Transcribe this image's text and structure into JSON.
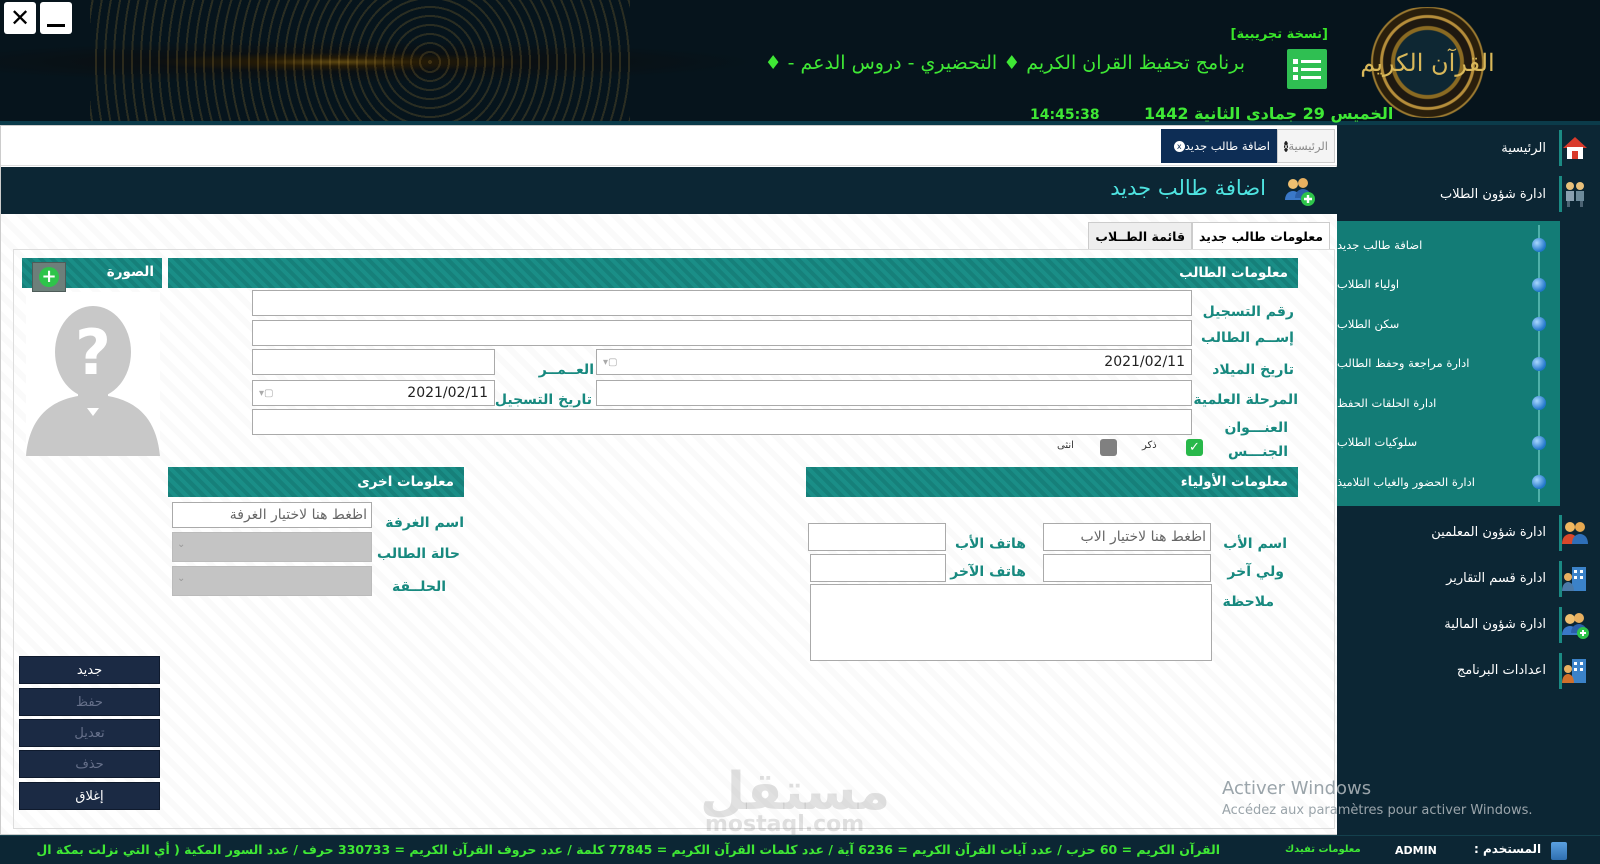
{
  "window": {
    "close_glyph": "✕"
  },
  "header": {
    "trial_badge": "[نسخة تجريبية]",
    "app_title": "برنامج تحفيظ القران الكريم ♦ التحضيري - دروس الدعم - ♦",
    "date": "الخميس 29 جمادى الثانية 1442",
    "time": "14:45:38",
    "seal_text": "القرآن الكريم"
  },
  "sidebar": {
    "items_top": [
      {
        "label": "الرئيسية",
        "icon": "home-icon"
      },
      {
        "label": "ادارة شؤون الطلاب",
        "icon": "students-icon"
      }
    ],
    "submenu": [
      "اضافة طالب جديد",
      "اولياء الطلاب",
      "سكن الطلاب",
      "ادارة مراجعة وحفظ الطالب",
      "ادارة الحلقات الحفظ",
      "سلوكيات الطلاب",
      "ادارة الحضور والغياب التلاميذ"
    ],
    "items_bottom": [
      {
        "label": "ادارة شؤون المعلمين",
        "icon": "teachers-icon"
      },
      {
        "label": "ادارة قسم التقارير",
        "icon": "reports-icon"
      },
      {
        "label": "ادارة شؤون المالية",
        "icon": "finance-icon"
      },
      {
        "label": "اعدادات البرنامج",
        "icon": "settings-icon"
      }
    ]
  },
  "tabs": {
    "home": "الرئيسية",
    "new_student": "اضافة طالب جديد",
    "close_glyph": "x"
  },
  "page": {
    "title": "اضافة طالب جديد",
    "subtabs": {
      "info": "معلومات طالب جديد",
      "list": "قائمة الطــلاب"
    }
  },
  "photo": {
    "label": "الصورة",
    "add_glyph": "+",
    "avatar_glyph": "?"
  },
  "student_info": {
    "section_title": "معلومات الطالب",
    "reg_number_label": "رقم التسجيل",
    "name_label": "إســم الطالب",
    "birth_date_label": "تاريخ الميلاد",
    "birth_date_value": "2021/02/11",
    "age_label": "العــمــر",
    "level_label": "المرحلة العلمية",
    "reg_date_label": "تاريخ التسجيل",
    "reg_date_value": "2021/02/11",
    "address_label": "العنـــوان",
    "gender_label": "الجنـــس",
    "male_label": "ذكر",
    "female_label": "انثى",
    "check_glyph": "✓"
  },
  "other_info": {
    "section_title": "معلومات اخرى",
    "room_label": "اسم الغرفة",
    "room_placeholder": "اظغط هنا لاختيار الغرفة",
    "status_label": "حالة الطالب",
    "circle_label": "الحلــقة"
  },
  "guardian_info": {
    "section_title": "معلومات الأولياء",
    "father_name_label": "اسم الأب",
    "father_name_placeholder": "اظغط هنا لاختيار الاب",
    "father_phone_label": "هاتف الأب",
    "other_guardian_label": "ولي آخر",
    "other_phone_label": "هاتف الآخر",
    "note_label": "ملاحظة"
  },
  "actions": {
    "new": "جديد",
    "save": "حفظ",
    "edit": "تعديل",
    "delete": "حذف",
    "close": "إغلاق"
  },
  "footer": {
    "ticker_title": "معلومات تفيدك",
    "ticker": "القرآن الكريم = 60 حزب / عدد آيات القرآن الكريم = 6236 آية / عدد كلمات القرآن الكريم = 77845 كلمة / عدد حروف القرآن الكريم = 330733 حرف / عدد السور المكية ( أي التي نزلت بمكة ال",
    "user_label": "المستخدم :",
    "user_name": "ADMIN"
  },
  "watermark": {
    "line1": "Activer Windows",
    "line2": "Accédez aux paramètres pour activer Windows."
  },
  "site_watermark": {
    "arabic": "مستقل",
    "latin": "mostaql.com"
  },
  "colors": {
    "accent": "#17897f",
    "green_text": "#3fe835",
    "dark_bg": "#0c2634",
    "tab_active": "#0d2d55"
  }
}
